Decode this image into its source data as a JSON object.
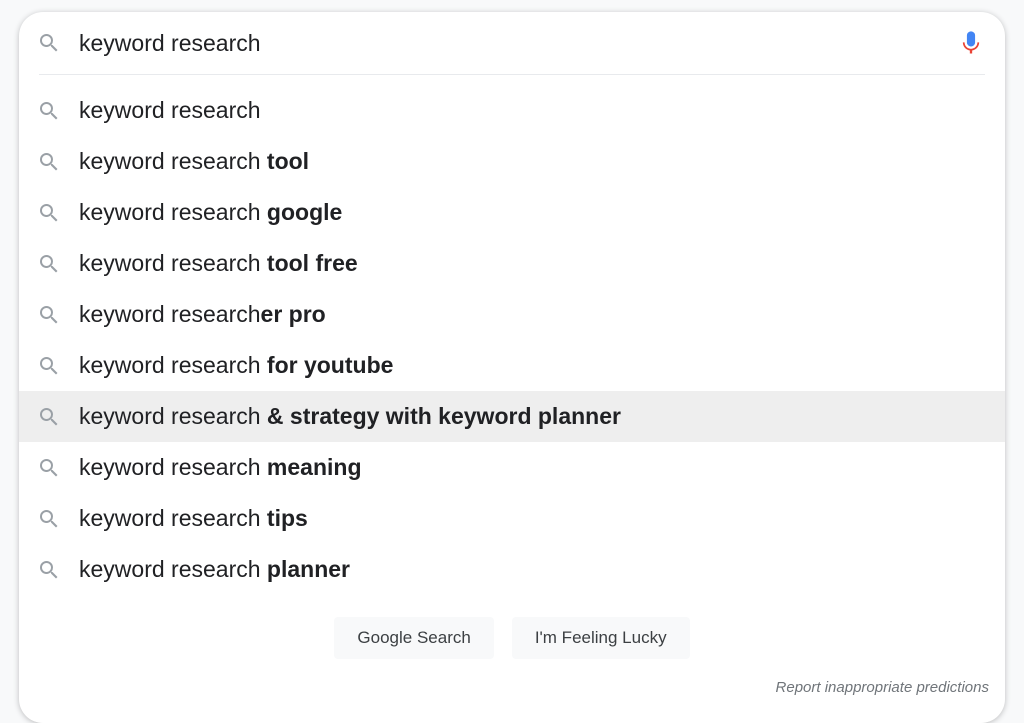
{
  "search": {
    "query": "keyword research",
    "placeholder": ""
  },
  "suggestions": [
    {
      "prefix": "keyword research",
      "bold": "",
      "highlighted": false
    },
    {
      "prefix": "keyword research ",
      "bold": "tool",
      "highlighted": false
    },
    {
      "prefix": "keyword research ",
      "bold": "google",
      "highlighted": false
    },
    {
      "prefix": "keyword research ",
      "bold": "tool free",
      "highlighted": false
    },
    {
      "prefix": "keyword research",
      "bold": "er pro",
      "highlighted": false
    },
    {
      "prefix": "keyword research ",
      "bold": "for youtube",
      "highlighted": false
    },
    {
      "prefix": "keyword research ",
      "bold": "& strategy with keyword planner",
      "highlighted": true
    },
    {
      "prefix": "keyword research ",
      "bold": "meaning",
      "highlighted": false
    },
    {
      "prefix": "keyword research ",
      "bold": "tips",
      "highlighted": false
    },
    {
      "prefix": "keyword research ",
      "bold": "planner",
      "highlighted": false
    }
  ],
  "buttons": {
    "search": "Google Search",
    "lucky": "I'm Feeling Lucky"
  },
  "footer": {
    "report": "Report inappropriate predictions"
  }
}
